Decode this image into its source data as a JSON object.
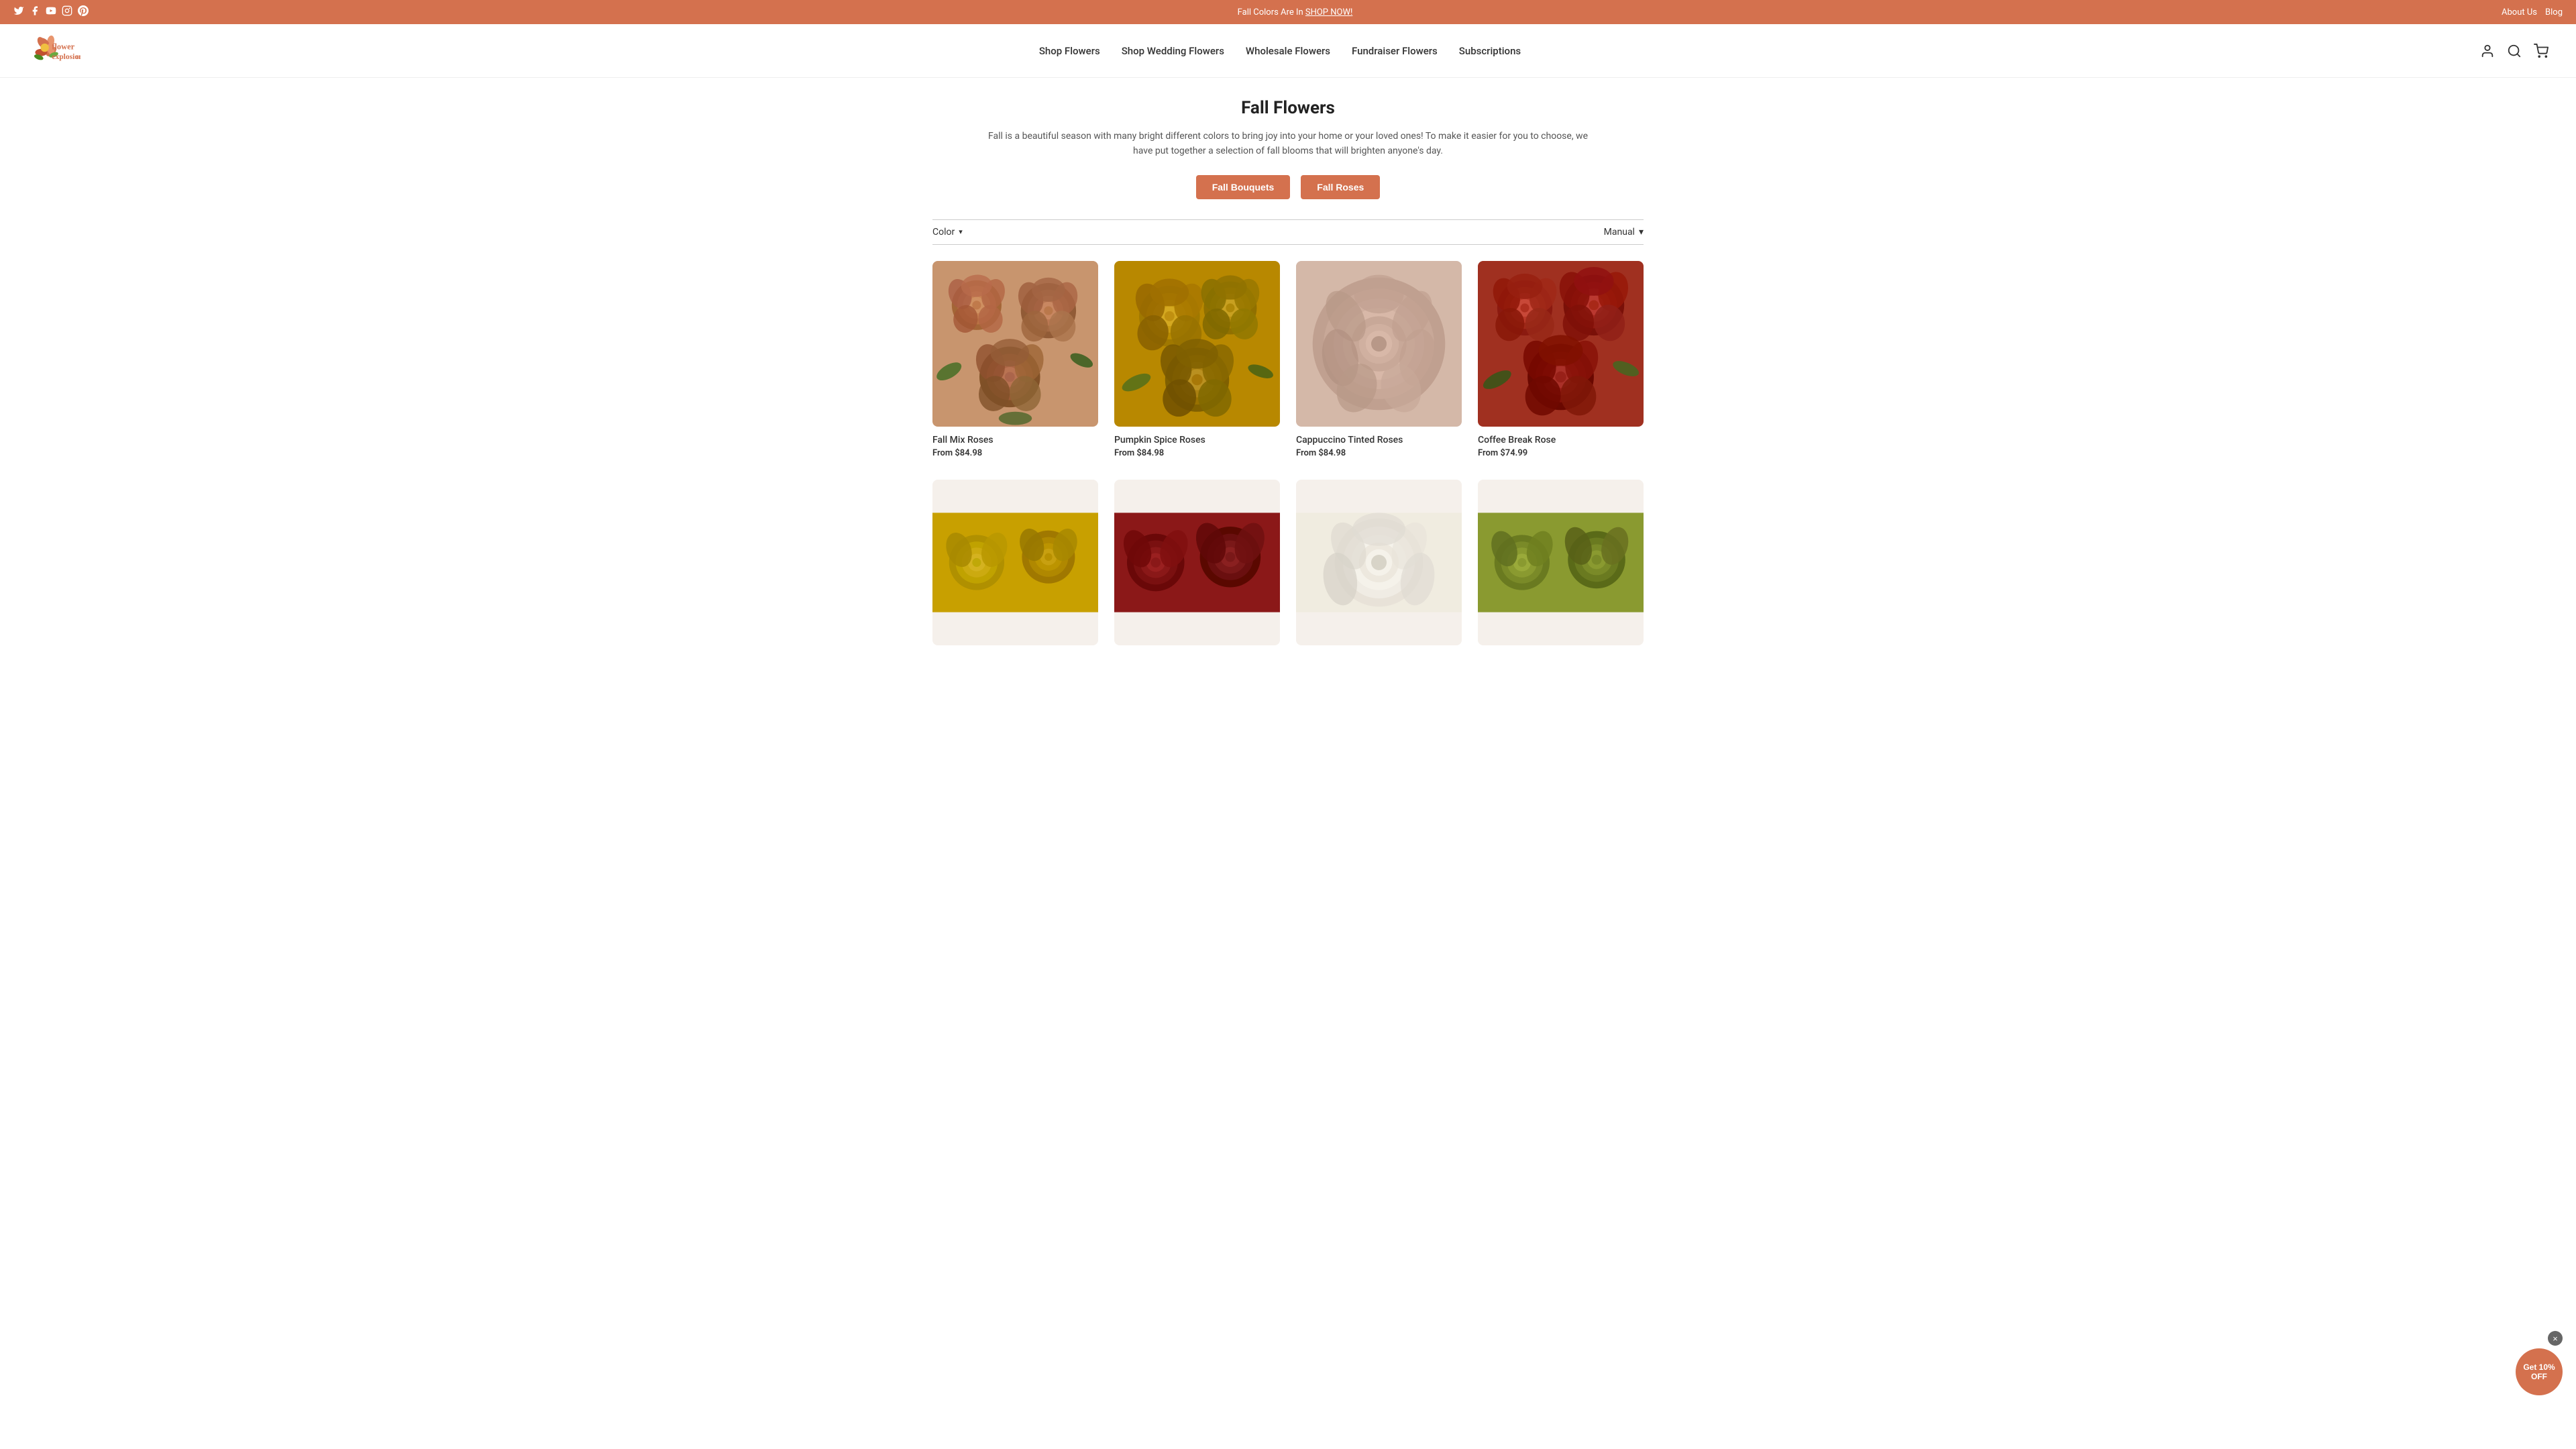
{
  "banner": {
    "text": "Fall Colors Are In ",
    "link_text": "SHOP NOW!",
    "link_url": "#"
  },
  "top_links": [
    {
      "label": "About Us",
      "url": "#"
    },
    {
      "label": "Blog",
      "url": "#"
    }
  ],
  "social_icons": [
    "twitter",
    "facebook",
    "youtube",
    "instagram",
    "pinterest"
  ],
  "header": {
    "logo_alt": "Flower Explosion",
    "nav_items": [
      {
        "label": "Shop Flowers",
        "url": "#"
      },
      {
        "label": "Shop Wedding Flowers",
        "url": "#"
      },
      {
        "label": "Wholesale Flowers",
        "url": "#"
      },
      {
        "label": "Fundraiser Flowers",
        "url": "#"
      },
      {
        "label": "Subscriptions",
        "url": "#"
      }
    ]
  },
  "page": {
    "title": "Fall Flowers",
    "description": "Fall is a beautiful season with many bright different colors to bring joy into your home or your loved ones! To make it easier for you to choose, we have put together a selection of fall blooms that will brighten anyone's day.",
    "cta_buttons": [
      {
        "label": "Fall Bouquets",
        "url": "#"
      },
      {
        "label": "Fall Roses",
        "url": "#"
      }
    ],
    "filter": {
      "color_label": "Color",
      "sort_label": "Manual"
    }
  },
  "products": [
    {
      "name": "Fall Mix Roses",
      "price_prefix": "From",
      "price": "$84.98",
      "image_class": "flower-img-1"
    },
    {
      "name": "Pumpkin Spice Roses",
      "price_prefix": "From",
      "price": "$84.98",
      "image_class": "flower-img-2"
    },
    {
      "name": "Cappuccino Tinted Roses",
      "price_prefix": "From",
      "price": "$84.98",
      "image_class": "flower-img-3"
    },
    {
      "name": "Coffee Break Rose",
      "price_prefix": "From",
      "price": "$74.99",
      "image_class": "flower-img-4"
    }
  ],
  "products_row2": [
    {
      "name": "",
      "price_prefix": "",
      "price": "",
      "image_class": "flower-img-5"
    },
    {
      "name": "",
      "price_prefix": "",
      "price": "",
      "image_class": "flower-img-6"
    },
    {
      "name": "",
      "price_prefix": "",
      "price": "",
      "image_class": "flower-img-7"
    },
    {
      "name": "",
      "price_prefix": "",
      "price": "",
      "image_class": "flower-img-8"
    }
  ],
  "discount": {
    "button_label": "Get 10%\nOFF",
    "close_label": "×"
  }
}
